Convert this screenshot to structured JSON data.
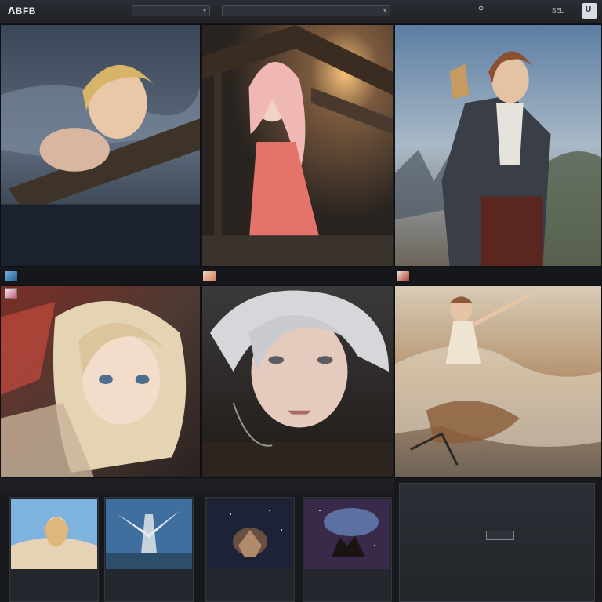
{
  "header": {
    "logo": "ᐱBFB",
    "search1_text": "",
    "search2_text": "",
    "pin_icon": "pin-icon",
    "nav_a": "",
    "nav_b": "",
    "nav_c": "SEL",
    "profile_glyph": "U"
  },
  "captions": {
    "cap1_text": "",
    "cap2_text": "",
    "cap2_right": "",
    "cap3_text": "",
    "cap3_right": ""
  },
  "bottom": {
    "strip_label": "",
    "cards": [
      {
        "meta": "",
        "title": "",
        "sub": ""
      },
      {
        "meta": "",
        "title": "",
        "sub": ""
      },
      {
        "meta": "",
        "title": "",
        "sub": ""
      },
      {
        "meta": "",
        "title": "",
        "sub": ""
      }
    ],
    "promo": {
      "title": "",
      "text": "",
      "button": ""
    }
  },
  "colors": {
    "background": "#1b1d22",
    "topbar": "#24262b",
    "caption_strip": "#15171b",
    "promo_panel": "#2b2e34"
  }
}
